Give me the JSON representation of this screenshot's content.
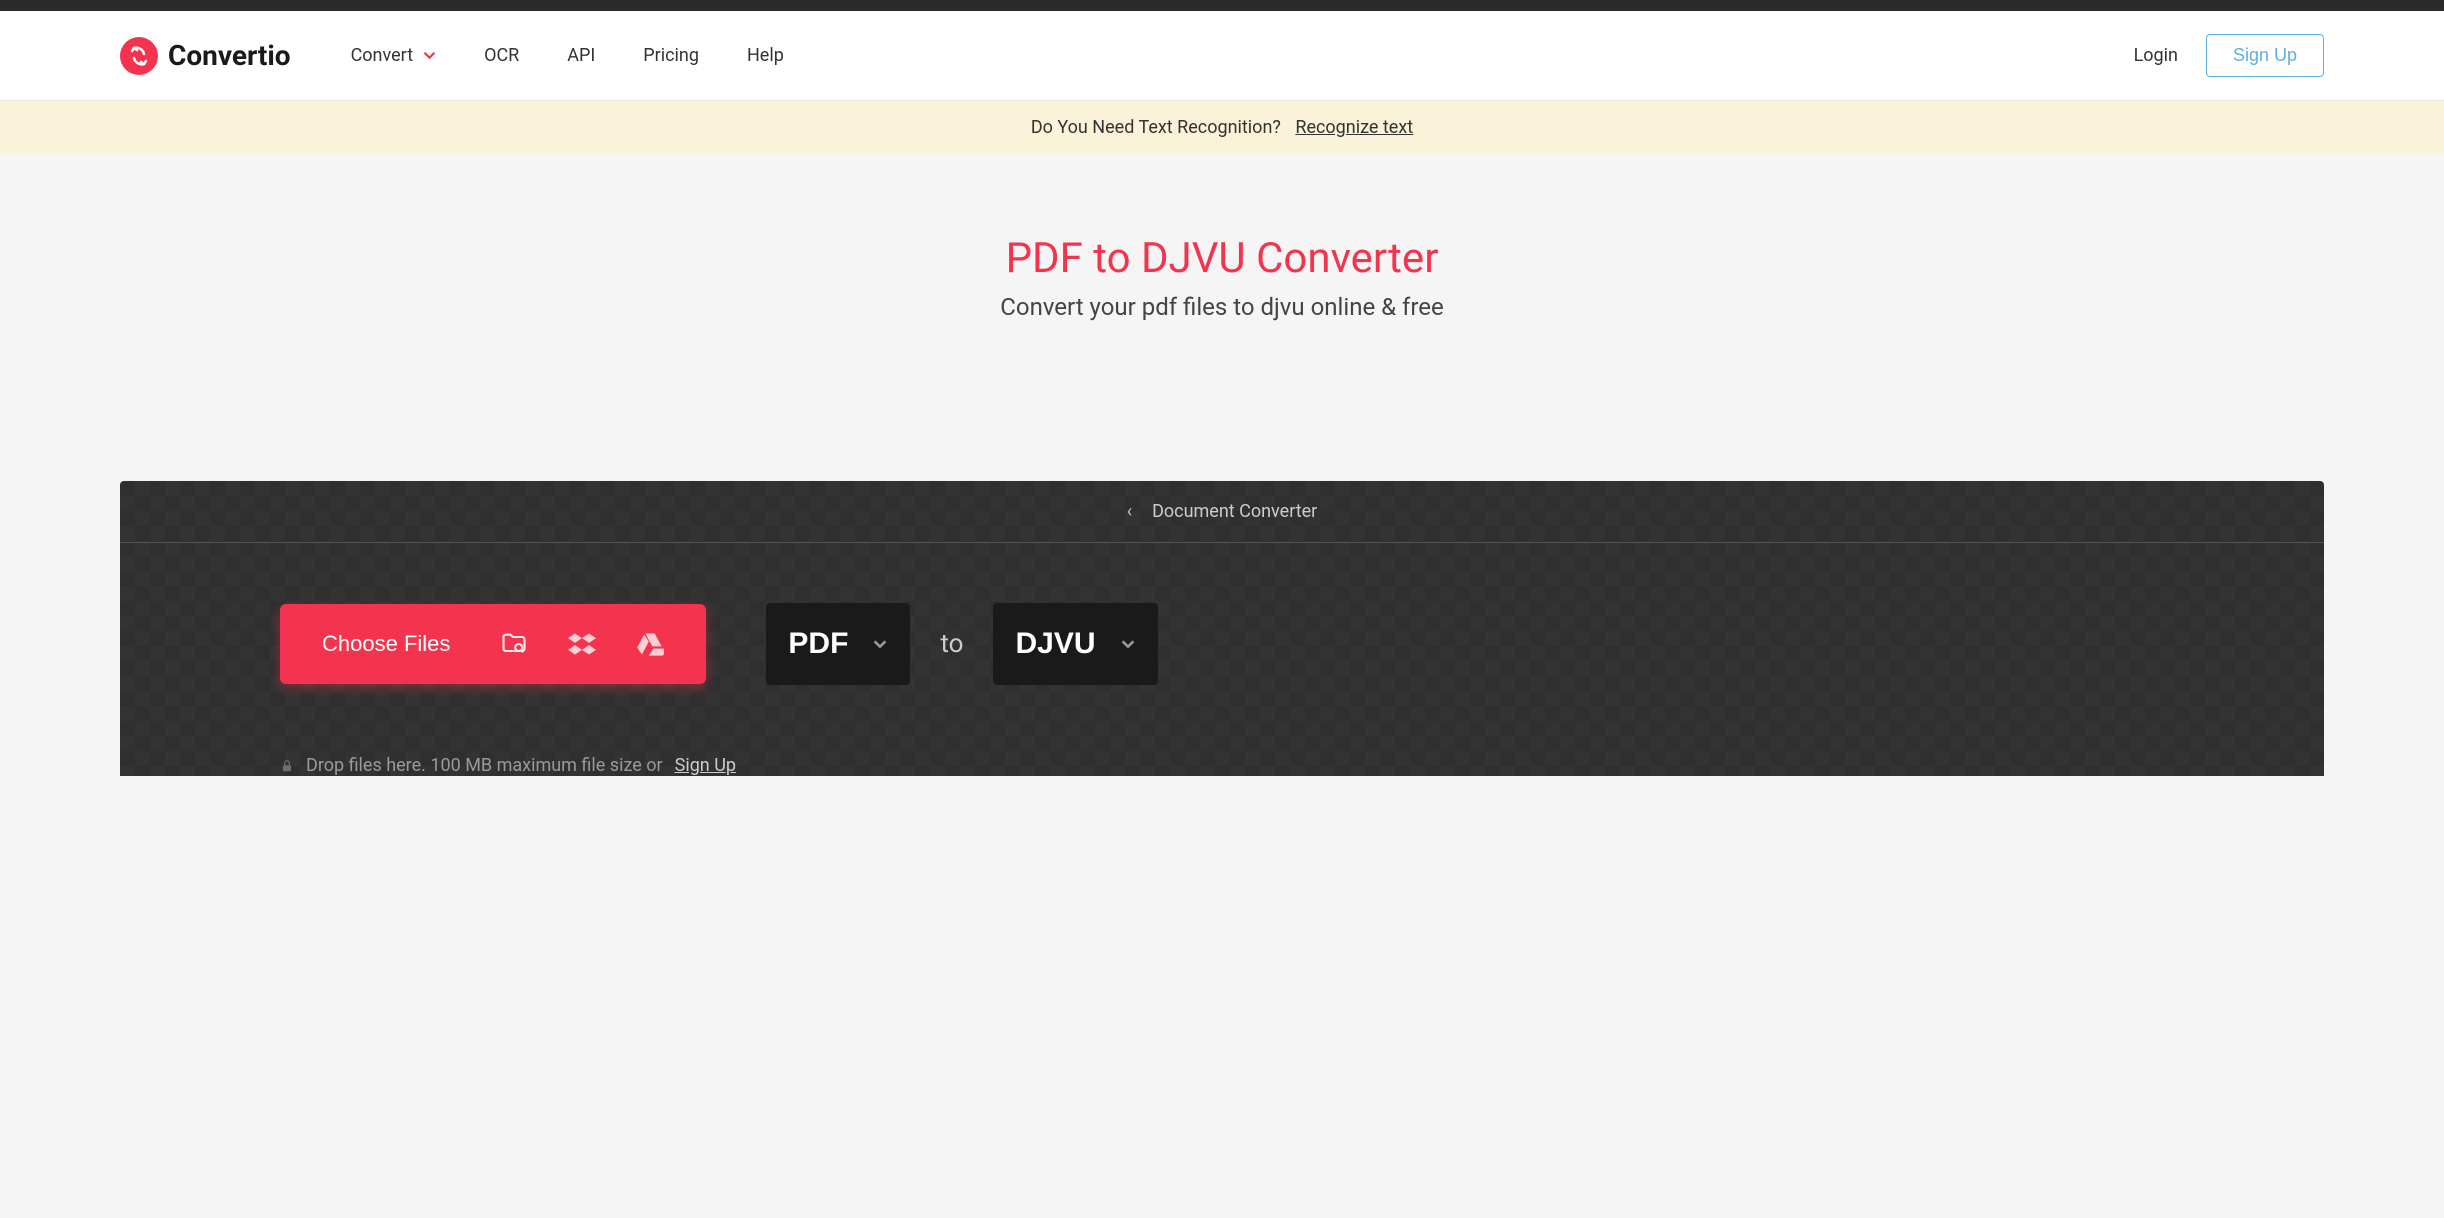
{
  "brand": "Convertio",
  "nav": {
    "convert": "Convert",
    "ocr": "OCR",
    "api": "API",
    "pricing": "Pricing",
    "help": "Help"
  },
  "auth": {
    "login": "Login",
    "signup": "Sign Up"
  },
  "banner": {
    "text": "Do You Need Text Recognition?",
    "link": "Recognize text"
  },
  "hero": {
    "title": "PDF to DJVU Converter",
    "subtitle": "Convert your pdf files to djvu online & free"
  },
  "panel": {
    "breadcrumb": "Document Converter",
    "choose": "Choose Files",
    "from": "PDF",
    "to_label": "to",
    "to": "DJVU",
    "drop_prefix": "Drop files here. 100 MB maximum file size or ",
    "drop_link": "Sign Up"
  }
}
